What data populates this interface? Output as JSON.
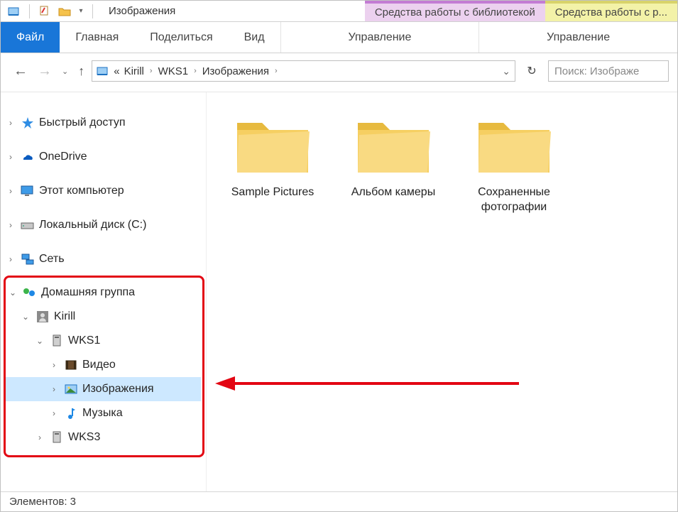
{
  "titlebar": {
    "window_title": "Изображения",
    "context_tab_1": "Средства работы с библиотекой",
    "context_tab_2": "Средства работы с р..."
  },
  "ribbon": {
    "file": "Файл",
    "home": "Главная",
    "share": "Поделиться",
    "view": "Вид",
    "group1": "Управление",
    "group2": "Управление"
  },
  "navrow": {
    "crumb_prefix": "«",
    "crumbs": [
      "Kirill",
      "WKS1",
      "Изображения"
    ],
    "search_placeholder": "Поиск: Изображе"
  },
  "tree": {
    "quick_access": "Быстрый доступ",
    "onedrive": "OneDrive",
    "this_pc": "Этот компьютер",
    "local_disk": "Локальный диск (C:)",
    "network": "Сеть",
    "homegroup": "Домашняя группа",
    "user": "Kirill",
    "wks1": "WKS1",
    "videos": "Видео",
    "pictures": "Изображения",
    "music": "Музыка",
    "wks3": "WKS3"
  },
  "content": {
    "folders": [
      {
        "label": "Sample Pictures"
      },
      {
        "label": "Альбом камеры"
      },
      {
        "label": "Сохраненные фотографии"
      }
    ]
  },
  "status": {
    "elements_label": "Элементов:",
    "elements_count": "3"
  }
}
